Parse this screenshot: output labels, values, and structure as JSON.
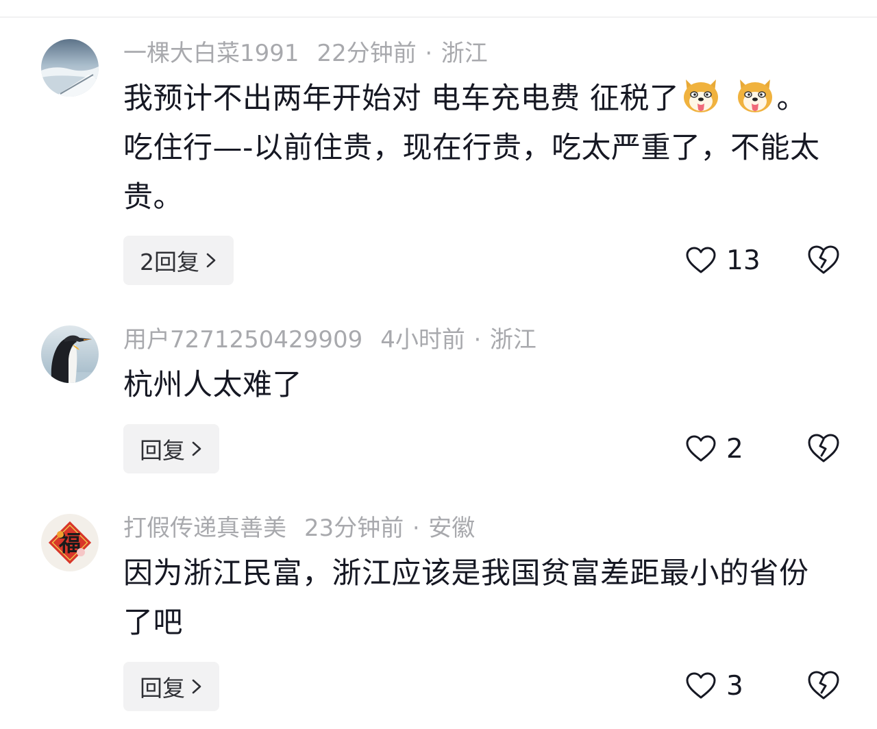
{
  "comments": [
    {
      "username": "一棵大白菜1991",
      "time": "22分钟前",
      "location": "浙江",
      "text_part1": "我预计不出两年开始对 电车充电费 征税了",
      "text_part2": "。 吃住行—-以前住贵，现在行贵，吃太严重了，不能太贵。",
      "reply_label": "2回复",
      "likes": "13"
    },
    {
      "username": "用户7271250429909",
      "time": "4小时前",
      "location": "浙江",
      "text": "杭州人太难了",
      "reply_label": "回复",
      "likes": "2"
    },
    {
      "username": "打假传递真善美",
      "time": "23分钟前",
      "location": "安徽",
      "text": "因为浙江民富，浙江应该是我国贫富差距最小的省份了吧",
      "reply_label": "回复",
      "likes": "3"
    }
  ],
  "separator": "·",
  "icons": {
    "like": "heart-outline-icon",
    "dislike": "broken-heart-icon",
    "reply_arrow": "chevron-right-icon",
    "emoji": "shiba-dog-emoji"
  },
  "avatar_stamp": "福",
  "colors": {
    "meta_text": "#a8a9ad",
    "body_text": "#161823",
    "reply_bg": "#f2f2f3"
  }
}
